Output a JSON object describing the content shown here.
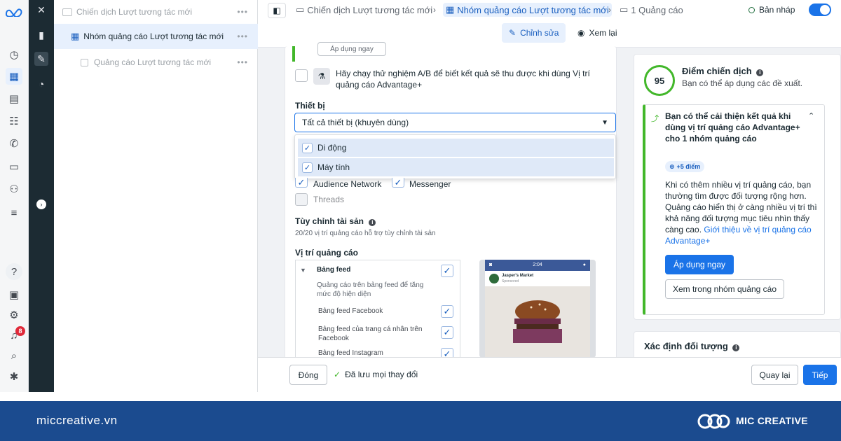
{
  "tree": {
    "campaign": "Chiến dịch Lượt tương tác mới",
    "adset": "Nhóm quảng cáo Lượt tương tác mới",
    "ad": "Quảng cáo Lượt tương tác mới",
    "more": "•••"
  },
  "topbar": {
    "crumb_campaign": "Chiến dịch Lượt tương tác mới",
    "crumb_adset": "Nhóm quảng cáo Lượt tương tác mới",
    "crumb_ad": "1 Quảng cáo",
    "status": "Bản nháp",
    "tab_edit": "Chỉnh sửa",
    "tab_review": "Xem lại"
  },
  "form": {
    "apply_now_partial": "Áp dụng ngay",
    "ab_test": "Hãy chạy thử nghiệm A/B để biết kết quả sẽ thu được khi dùng Vị trí quảng cáo Advantage+",
    "devices_label": "Thiết bị",
    "devices_value": "Tất cả thiết bị (khuyên dùng)",
    "device_options": [
      "Di động",
      "Máy tính"
    ],
    "platforms": {
      "audience_network": "Audience Network",
      "messenger": "Messenger",
      "threads": "Threads"
    },
    "asset_title": "Tùy chỉnh tài sản",
    "asset_sub": "20/20 vị trí quảng cáo hỗ trợ tùy chỉnh tài sản",
    "placements_title": "Vị trí quảng cáo",
    "feed_title": "Bảng feed",
    "feed_desc": "Quảng cáo trên bảng feed để tăng mức độ hiện diện",
    "feed_items": [
      "Bảng feed Facebook",
      "Bảng feed của trang cá nhân trên Facebook",
      "Bảng feed Instagram"
    ]
  },
  "preview": {
    "time": "2:04",
    "page_name": "Jasper's Market",
    "sponsored": "Sponsored"
  },
  "score": {
    "value": "95",
    "title": "Điểm chiến dịch",
    "sub": "Bạn có thể áp dụng các đề xuất.",
    "rec_title": "Bạn có thể cải thiện kết quả khi dùng vị trí quảng cáo Advantage+ cho 1 nhóm quảng cáo",
    "points": "+5 điểm",
    "rec_body": "Khi có thêm nhiều vị trí quảng cáo, bạn thường tìm được đối tượng rộng hơn. Quảng cáo hiển thị ở càng nhiều vị trí thì khả năng đối tượng mục tiêu nhìn thấy càng cao.",
    "rec_link": "Giới thiệu về vị trí quảng cáo Advantage+",
    "apply": "Áp dụng ngay",
    "view_in_adset": "Xem trong nhóm quảng cáo",
    "audience_title": "Xác định đối tượng"
  },
  "footer": {
    "close": "Đóng",
    "saved": "Đã lưu mọi thay đổi",
    "back": "Quay lại",
    "next": "Tiếp"
  },
  "rail": {
    "notif_count": "8"
  },
  "brand": {
    "site": "miccreative.vn",
    "name": "MIC CREATIVE"
  },
  "colors": {
    "accent": "#1a73e8",
    "brand_bar": "#1b4b8f",
    "dark_rail": "#1c2b33",
    "score_ring": "#42b72a"
  }
}
